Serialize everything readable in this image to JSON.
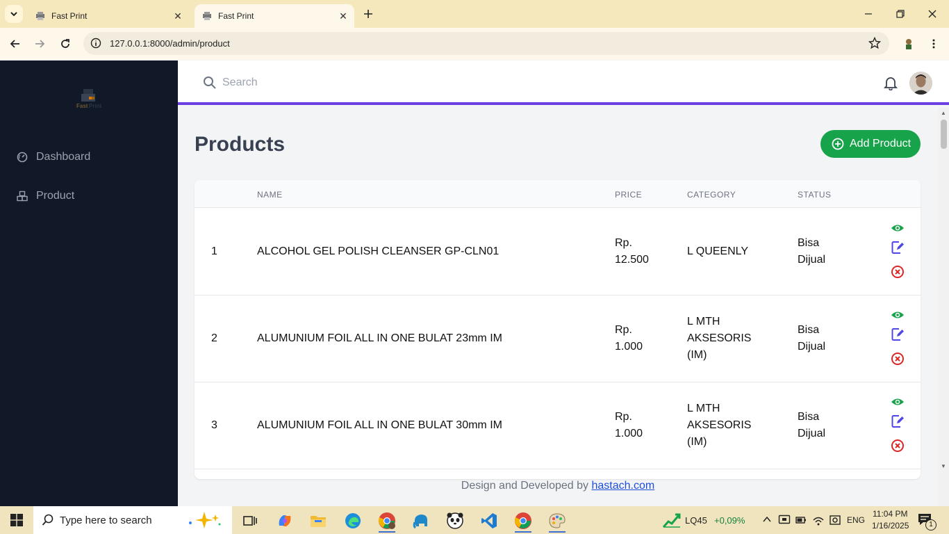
{
  "browser": {
    "tabs": [
      {
        "title": "Fast Print"
      },
      {
        "title": "Fast Print"
      }
    ],
    "url": "127.0.0.1:8000/admin/product"
  },
  "sidebar": {
    "logo_text": "FastPrint",
    "items": [
      {
        "label": "Dashboard"
      },
      {
        "label": "Product"
      }
    ]
  },
  "topbar": {
    "search_placeholder": "Search"
  },
  "page": {
    "title": "Products",
    "add_button": "Add Product"
  },
  "table": {
    "headers": [
      "NAME",
      "PRICE",
      "CATEGORY",
      "STATUS"
    ],
    "rows": [
      {
        "no": "1",
        "name": "ALCOHOL GEL POLISH CLEANSER GP-CLN01",
        "price": [
          "Rp.",
          "12.500"
        ],
        "category": [
          "L QUEENLY"
        ],
        "status": [
          "Bisa",
          "Dijual"
        ]
      },
      {
        "no": "2",
        "name": "ALUMUNIUM FOIL ALL IN ONE BULAT 23mm IM",
        "price": [
          "Rp.",
          "1.000"
        ],
        "category": [
          "L MTH",
          "AKSESORIS",
          "(IM)"
        ],
        "status": [
          "Bisa",
          "Dijual"
        ]
      },
      {
        "no": "3",
        "name": "ALUMUNIUM FOIL ALL IN ONE BULAT 30mm IM",
        "price": [
          "Rp.",
          "1.000"
        ],
        "category": [
          "L MTH",
          "AKSESORIS",
          "(IM)"
        ],
        "status": [
          "Bisa",
          "Dijual"
        ]
      }
    ]
  },
  "footer": {
    "text": "Design and Developed by",
    "link": "hastach.com"
  },
  "taskbar": {
    "search_placeholder": "Type here to search",
    "stock_name": "LQ45",
    "stock_change": "+0,09%",
    "language": "ENG",
    "time": "11:04 PM",
    "date": "1/16/2025",
    "notification_count": "1"
  },
  "colors": {
    "sidebar_bg": "#111827",
    "accent": "#6d3fe0",
    "add_button": "#16a34a",
    "view_icon": "#16a34a",
    "edit_icon": "#4f46e5",
    "delete_icon": "#dc2626"
  }
}
